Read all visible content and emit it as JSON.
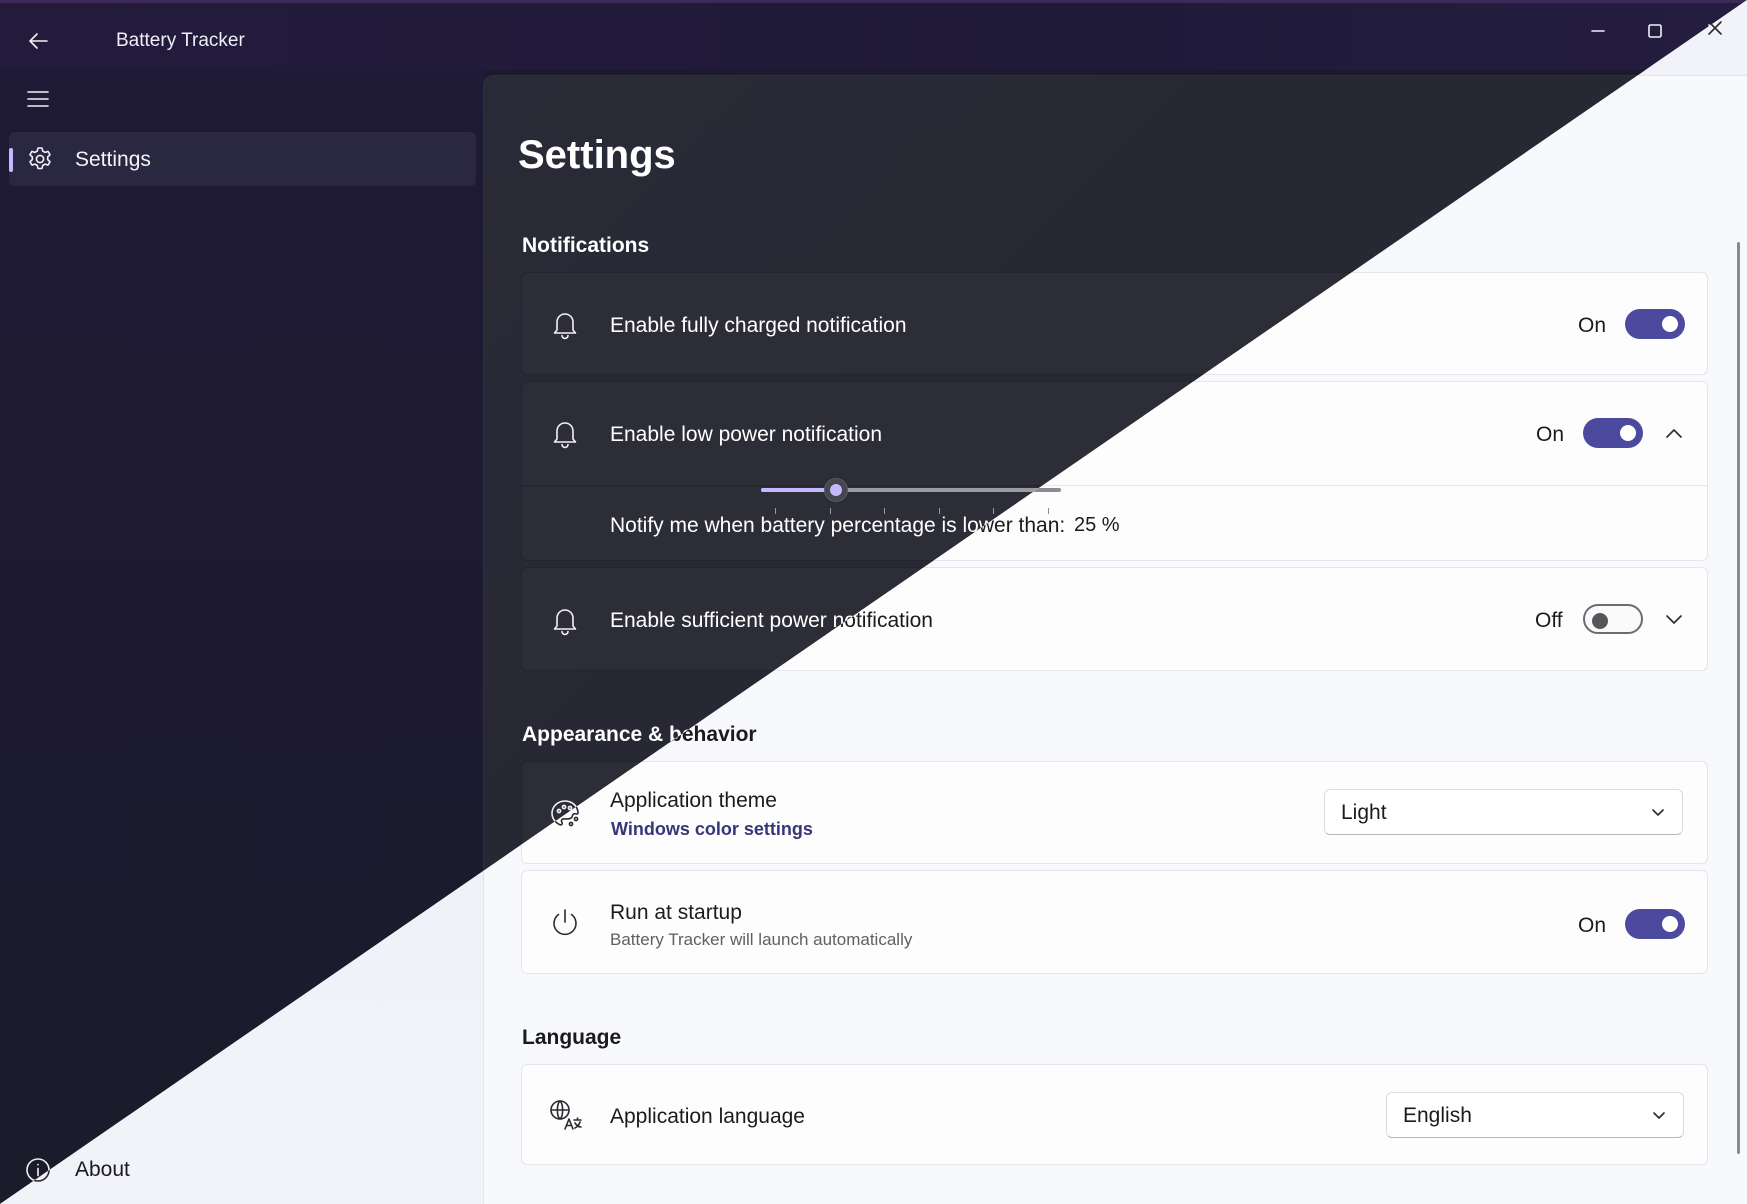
{
  "window": {
    "title": "Battery Tracker",
    "controls": {
      "minimize_icon": "minimize-icon",
      "maximize_icon": "maximize-icon",
      "close_icon": "close-icon"
    }
  },
  "nav": {
    "back_icon": "back-arrow-icon",
    "menu_icon": "hamburger-menu-icon",
    "items": [
      {
        "label": "Settings",
        "icon": "gear-icon",
        "selected": true
      }
    ],
    "footer": {
      "label": "About",
      "icon": "info-icon"
    }
  },
  "page": {
    "title": "Settings"
  },
  "sections": {
    "notifications": {
      "heading": "Notifications",
      "fully_charged": {
        "label": "Enable fully charged notification",
        "state": "On",
        "on": true,
        "icon": "bell-icon"
      },
      "low_power": {
        "label": "Enable low power notification",
        "state": "On",
        "on": true,
        "expanded": true,
        "icon": "bell-icon",
        "threshold_label": "Notify me when battery percentage is lower than:",
        "threshold_value": 25,
        "threshold_display": "25 %"
      },
      "sufficient_power": {
        "label": "Enable sufficient power notification",
        "state": "Off",
        "on": false,
        "expanded": false,
        "icon": "bell-icon"
      }
    },
    "appearance": {
      "heading": "Appearance & behavior",
      "theme": {
        "label": "Application theme",
        "link": "Windows color settings",
        "value": "Light",
        "icon": "palette-icon"
      },
      "startup": {
        "label": "Run at startup",
        "description": "Battery Tracker will launch automatically",
        "state": "On",
        "on": true,
        "icon": "power-icon"
      }
    },
    "language": {
      "heading": "Language",
      "app_language": {
        "label": "Application language",
        "value": "English",
        "icon": "language-icon"
      }
    }
  },
  "colors": {
    "accent_dark": "#c4b9ff",
    "accent_light": "#4b4a9e"
  }
}
